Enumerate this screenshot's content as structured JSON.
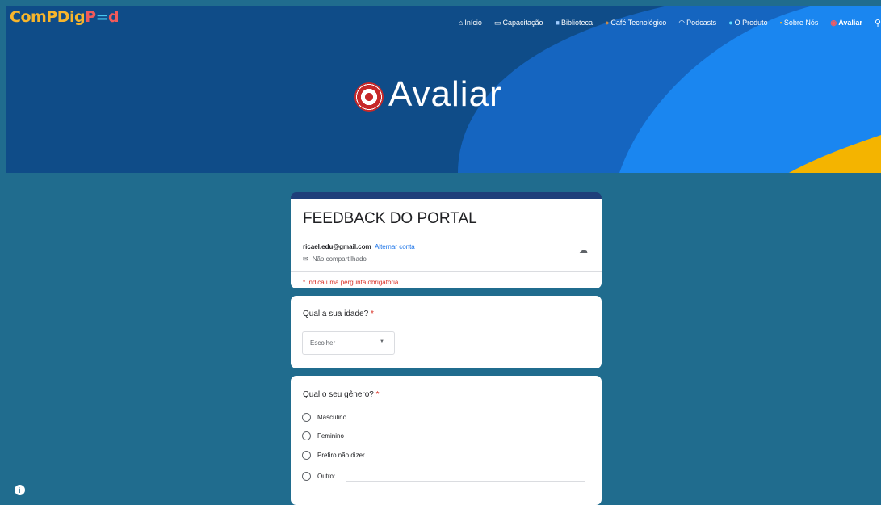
{
  "site": {
    "logo_parts": [
      "Com",
      "P",
      "D",
      "ig",
      "P",
      "=",
      "d"
    ]
  },
  "nav": [
    {
      "label": "Início",
      "icon": "home-icon"
    },
    {
      "label": "Capacitação",
      "icon": "laptop-icon"
    },
    {
      "label": "Biblioteca",
      "icon": "book-icon"
    },
    {
      "label": "Café Tecnológico",
      "icon": "coffee-icon"
    },
    {
      "label": "Podcasts",
      "icon": "headphones-icon"
    },
    {
      "label": "O Produto",
      "icon": "pin-icon"
    },
    {
      "label": "Sobre Nós",
      "icon": "people-icon"
    },
    {
      "label": "Avaliar",
      "icon": "target-icon"
    }
  ],
  "hero": {
    "title": "Avaliar"
  },
  "form": {
    "title": "FEEDBACK DO PORTAL",
    "email": "ricael.edu@gmail.com",
    "switch_account": "Alternar conta",
    "not_shared": "Não compartilhado",
    "required_note": "* Indica uma pergunta obrigatória"
  },
  "q_age": {
    "label": "Qual a sua idade?",
    "required": "*",
    "select_placeholder": "Escolher"
  },
  "q_gender": {
    "label": "Qual o seu gênero?",
    "required": "*",
    "options": [
      "Masculino",
      "Feminino",
      "Prefiro não dizer",
      "Outro:"
    ]
  },
  "colors": {
    "header_bg": "#0f4c88",
    "page_bg": "#206c8e",
    "accent_required": "#d93025",
    "link": "#1a73e8"
  }
}
